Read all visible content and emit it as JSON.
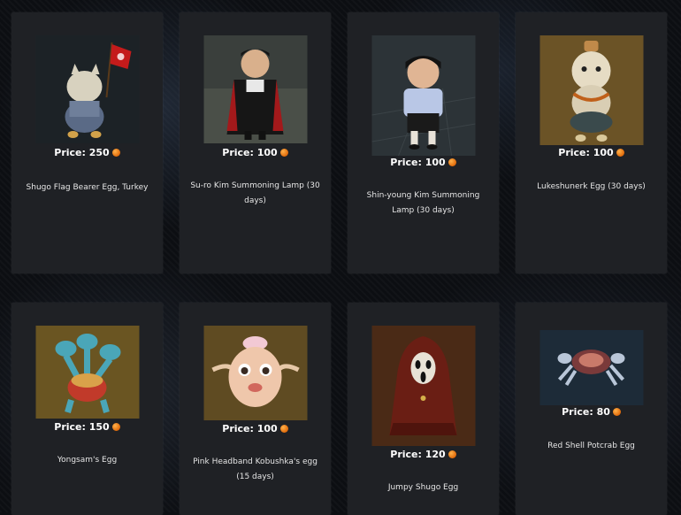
{
  "currency_icon": "coin-icon",
  "items": [
    {
      "price": "Price: 250",
      "name": "Shugo Flag Bearer Egg, Turkey"
    },
    {
      "price": "Price: 100",
      "name": "Su-ro Kim Summoning Lamp (30 days)"
    },
    {
      "price": "Price: 100",
      "name": "Shin-young Kim Summoning Lamp (30 days)"
    },
    {
      "price": "Price: 100",
      "name": "Lukeshunerk Egg (30 days)"
    },
    {
      "price": "Price: 150",
      "name": "Yongsam's Egg"
    },
    {
      "price": "Price: 100",
      "name": "Pink Headband Kobushka's egg (15 days)"
    },
    {
      "price": "Price: 120",
      "name": "Jumpy Shugo Egg"
    },
    {
      "price": "Price: 80",
      "name": "Red Shell Potcrab Egg"
    }
  ]
}
